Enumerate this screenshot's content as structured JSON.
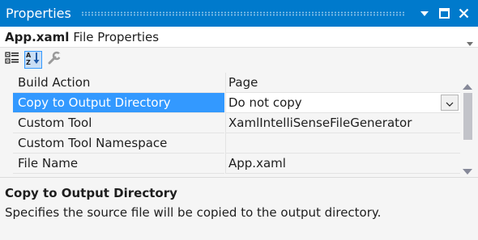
{
  "window": {
    "title": "Properties",
    "controls": {
      "menu_icon": "dropdown-arrow-icon",
      "maximize_icon": "maximize-icon",
      "close_icon": "close-icon"
    }
  },
  "object_selector": {
    "name": "App.xaml",
    "type": "File Properties"
  },
  "toolbar": {
    "buttons": [
      {
        "icon": "categorized-icon",
        "active": false
      },
      {
        "icon": "alphabetical-sort-icon",
        "active": true
      },
      {
        "icon": "wrench-icon",
        "active": false
      }
    ]
  },
  "properties": [
    {
      "name": "Build Action",
      "value": "Page"
    },
    {
      "name": "Copy to Output Directory",
      "value": "Do not copy",
      "selected": true
    },
    {
      "name": "Custom Tool",
      "value": "XamlIntelliSenseFileGenerator"
    },
    {
      "name": "Custom Tool Namespace",
      "value": ""
    },
    {
      "name": "File Name",
      "value": "App.xaml"
    }
  ],
  "description": {
    "title": "Copy to Output Directory",
    "text": "Specifies the source file will be copied to the output directory."
  },
  "colors": {
    "title_bar": "#007acc",
    "selection": "#3399ff",
    "background": "#f5f5f5"
  }
}
